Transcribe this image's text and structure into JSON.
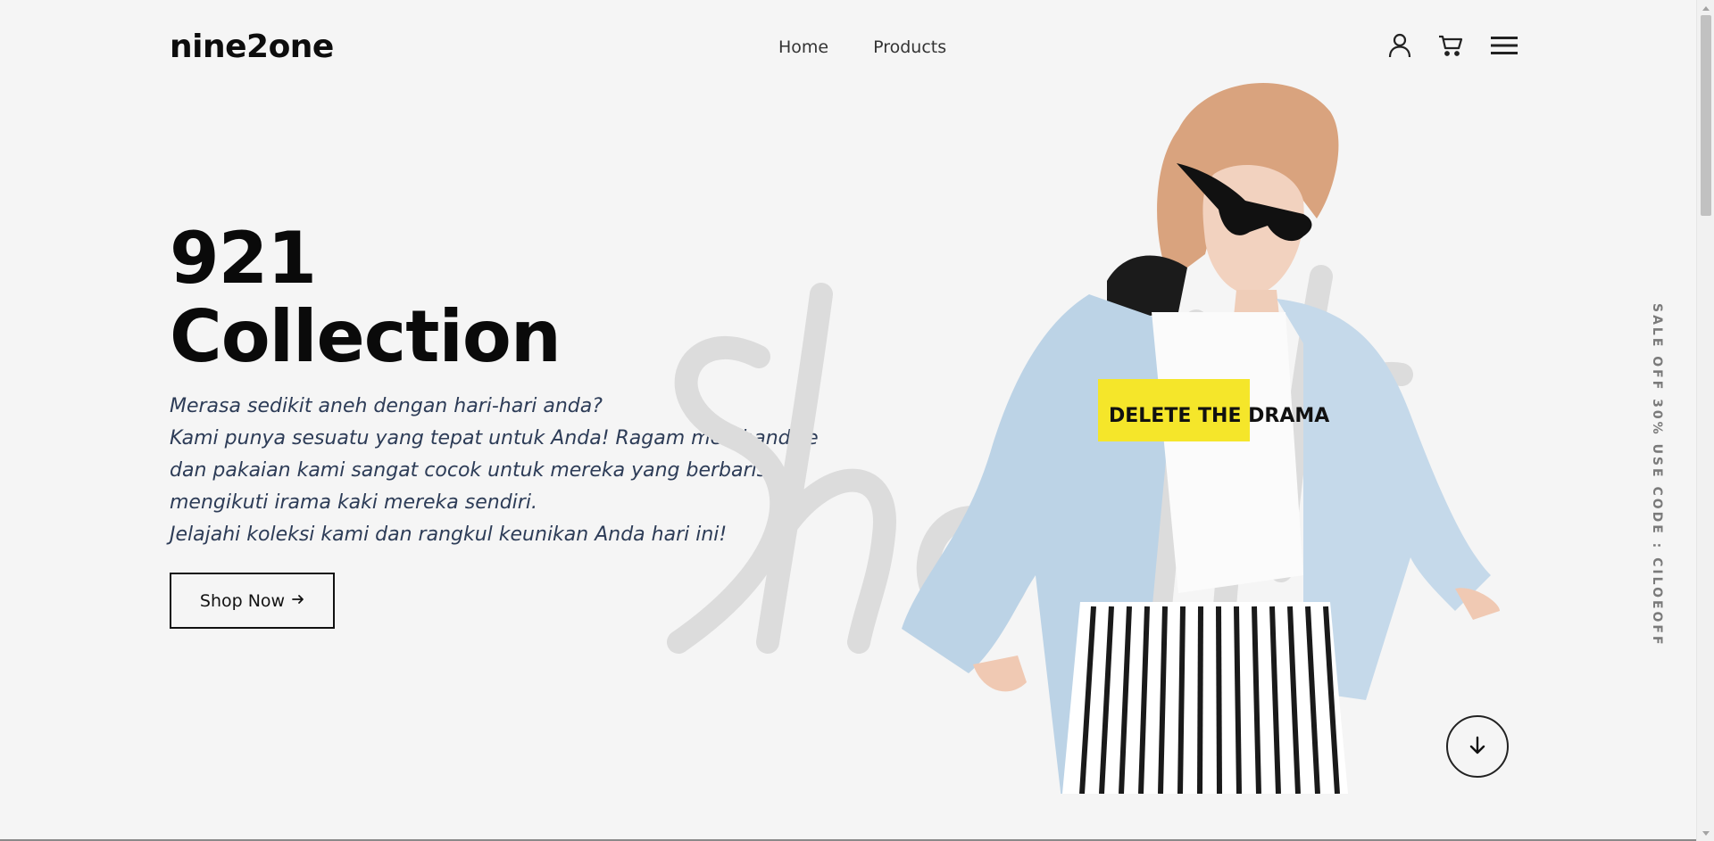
{
  "header": {
    "logo": "nine2one",
    "nav": [
      "Home",
      "Products"
    ],
    "icons": [
      "user-icon",
      "cart-icon",
      "menu-icon"
    ]
  },
  "hero": {
    "title_line1": "921",
    "title_line2": "Collection",
    "description": [
      "Merasa sedikit aneh dengan hari-hari anda?",
      "Kami punya sesuatu yang tepat untuk Anda! Ragam merchandise",
      "dan pakaian kami sangat cocok untuk mereka yang berbaris",
      "mengikuti irama kaki mereka sendiri.",
      "Jelajahi koleksi kami dan rangkul keunikan Anda hari ini!"
    ],
    "button_label": "Shop Now",
    "button_icon": "arrow-right-icon",
    "scroll_icon": "arrow-down-icon",
    "background_script": "Shopping",
    "shirt_print": "DELETE THE DRAMA"
  },
  "side_banner": "SALE OFF 30% USE CODE : CILOEOFF",
  "colors": {
    "background": "#f5f5f5",
    "text_dark": "#0a0a0a",
    "description": "#2d3c57",
    "accent_shirt": "#f5e62a",
    "denim": "#bcd3e6"
  }
}
